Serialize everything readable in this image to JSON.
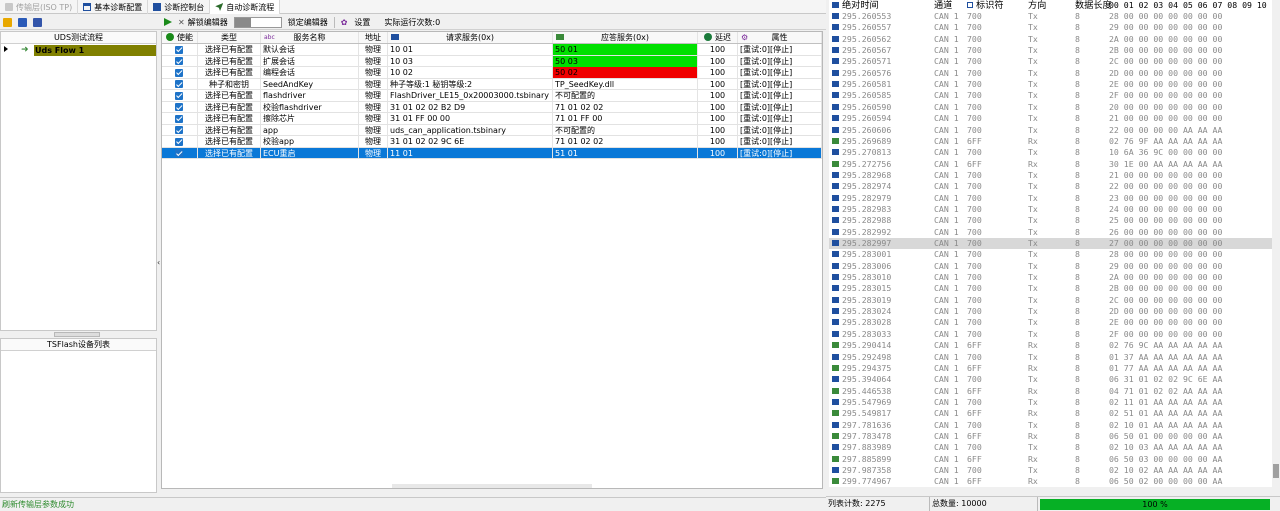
{
  "tabs": [
    {
      "label": "传输层(ISO TP)",
      "state": "disabled"
    },
    {
      "label": "基本诊断配置",
      "state": "normal"
    },
    {
      "label": "诊断控制台",
      "state": "normal"
    },
    {
      "label": "自动诊断流程",
      "state": "active"
    }
  ],
  "toolbar": {
    "unlock_editor": "解锁编辑器",
    "lock_editor": "锁定编辑器",
    "settings": "设置",
    "run_count": "实际运行次数:0"
  },
  "flow_panel": {
    "title": "UDS测试流程",
    "items": [
      {
        "label": "Uds Flow 1"
      }
    ]
  },
  "device_panel": {
    "title": "TSFlash设备列表"
  },
  "grid": {
    "columns": {
      "enable": "使能",
      "type": "类型",
      "service_name": "服务名称",
      "address": "地址",
      "request": "请求服务(0x)",
      "response": "应答服务(0x)",
      "delay": "延迟",
      "attr": "属性"
    },
    "rows": [
      {
        "type": "选择已有配置",
        "name": "默认会话",
        "addr": "物理",
        "req": "10 01",
        "resp": "50 01",
        "resp_color": "green",
        "delay": "100",
        "attr": "[重试:0][停止]"
      },
      {
        "type": "选择已有配置",
        "name": "扩展会话",
        "addr": "物理",
        "req": "10 03",
        "resp": "50 03",
        "resp_color": "green",
        "delay": "100",
        "attr": "[重试:0][停止]"
      },
      {
        "type": "选择已有配置",
        "name": "编程会话",
        "addr": "物理",
        "req": "10 02",
        "resp": "50 02",
        "resp_color": "red",
        "delay": "100",
        "attr": "[重试:0][停止]"
      },
      {
        "type": "种子和密钥",
        "name": "SeedAndKey",
        "addr": "物理",
        "req": "种子等级:1 秘钥等级:2",
        "resp": "TP_SeedKey.dll",
        "resp_color": "",
        "delay": "100",
        "attr": "[重试:0][停止]"
      },
      {
        "type": "选择已有配置",
        "name": "flashdriver",
        "addr": "物理",
        "req": "FlashDriver_LE15_0x20003000.tsbinary",
        "resp": "不可配置的",
        "resp_color": "",
        "delay": "100",
        "attr": "[重试:0][停止]"
      },
      {
        "type": "选择已有配置",
        "name": "校验flashdriver",
        "addr": "物理",
        "req": "31 01 02 02 B2 D9",
        "resp": "71 01 02 02",
        "resp_color": "",
        "delay": "100",
        "attr": "[重试:0][停止]"
      },
      {
        "type": "选择已有配置",
        "name": "擦除芯片",
        "addr": "物理",
        "req": "31 01 FF 00 00",
        "resp": "71 01 FF 00",
        "resp_color": "",
        "delay": "100",
        "attr": "[重试:0][停止]"
      },
      {
        "type": "选择已有配置",
        "name": "app",
        "addr": "物理",
        "req": "uds_can_application.tsbinary",
        "resp": "不可配置的",
        "resp_color": "",
        "delay": "100",
        "attr": "[重试:0][停止]"
      },
      {
        "type": "选择已有配置",
        "name": "校验app",
        "addr": "物理",
        "req": "31 01 02 02 9C 6E",
        "resp": "71 01 02 02",
        "resp_color": "",
        "delay": "100",
        "attr": "[重试:0][停止]"
      },
      {
        "type": "选择已有配置",
        "name": "ECU重启",
        "addr": "物理",
        "req": "11 01",
        "resp": "51 01",
        "resp_color": "",
        "delay": "100",
        "attr": "[重试:0][停止]",
        "selected": true
      }
    ]
  },
  "status": {
    "message": "刷新传输层参数成功"
  },
  "log": {
    "columns": {
      "time": "绝对时间",
      "channel": "通道",
      "id": "标识符",
      "dir": "方向",
      "dlc": "数据长度",
      "data": "00 01 02 03 04 05 06 07 08 09 10"
    },
    "rows": [
      {
        "t": "295.260553",
        "ch": "CAN 1",
        "id": "700",
        "dir": "Tx",
        "dlc": "8",
        "data": "28 00 00 00 00 00 00 00"
      },
      {
        "t": "295.260557",
        "ch": "CAN 1",
        "id": "700",
        "dir": "Tx",
        "dlc": "8",
        "data": "29 00 00 00 00 00 00 00"
      },
      {
        "t": "295.260562",
        "ch": "CAN 1",
        "id": "700",
        "dir": "Tx",
        "dlc": "8",
        "data": "2A 00 00 00 00 00 00 00"
      },
      {
        "t": "295.260567",
        "ch": "CAN 1",
        "id": "700",
        "dir": "Tx",
        "dlc": "8",
        "data": "2B 00 00 00 00 00 00 00"
      },
      {
        "t": "295.260571",
        "ch": "CAN 1",
        "id": "700",
        "dir": "Tx",
        "dlc": "8",
        "data": "2C 00 00 00 00 00 00 00"
      },
      {
        "t": "295.260576",
        "ch": "CAN 1",
        "id": "700",
        "dir": "Tx",
        "dlc": "8",
        "data": "2D 00 00 00 00 00 00 00"
      },
      {
        "t": "295.260581",
        "ch": "CAN 1",
        "id": "700",
        "dir": "Tx",
        "dlc": "8",
        "data": "2E 00 00 00 00 00 00 00"
      },
      {
        "t": "295.260585",
        "ch": "CAN 1",
        "id": "700",
        "dir": "Tx",
        "dlc": "8",
        "data": "2F 00 00 00 00 00 00 00"
      },
      {
        "t": "295.260590",
        "ch": "CAN 1",
        "id": "700",
        "dir": "Tx",
        "dlc": "8",
        "data": "20 00 00 00 00 00 00 00"
      },
      {
        "t": "295.260594",
        "ch": "CAN 1",
        "id": "700",
        "dir": "Tx",
        "dlc": "8",
        "data": "21 00 00 00 00 00 00 00"
      },
      {
        "t": "295.260606",
        "ch": "CAN 1",
        "id": "700",
        "dir": "Tx",
        "dlc": "8",
        "data": "22 00 00 00 00 AA AA AA"
      },
      {
        "t": "295.269689",
        "ch": "CAN 1",
        "id": "6FF",
        "dir": "Rx",
        "dlc": "8",
        "data": "02 76 9F AA AA AA AA AA"
      },
      {
        "t": "295.270813",
        "ch": "CAN 1",
        "id": "700",
        "dir": "Tx",
        "dlc": "8",
        "data": "10 6A 36 9C 00 00 00 00"
      },
      {
        "t": "295.272756",
        "ch": "CAN 1",
        "id": "6FF",
        "dir": "Rx",
        "dlc": "8",
        "data": "30 1E 00 AA AA AA AA AA"
      },
      {
        "t": "295.282968",
        "ch": "CAN 1",
        "id": "700",
        "dir": "Tx",
        "dlc": "8",
        "data": "21 00 00 00 00 00 00 00"
      },
      {
        "t": "295.282974",
        "ch": "CAN 1",
        "id": "700",
        "dir": "Tx",
        "dlc": "8",
        "data": "22 00 00 00 00 00 00 00"
      },
      {
        "t": "295.282979",
        "ch": "CAN 1",
        "id": "700",
        "dir": "Tx",
        "dlc": "8",
        "data": "23 00 00 00 00 00 00 00"
      },
      {
        "t": "295.282983",
        "ch": "CAN 1",
        "id": "700",
        "dir": "Tx",
        "dlc": "8",
        "data": "24 00 00 00 00 00 00 00"
      },
      {
        "t": "295.282988",
        "ch": "CAN 1",
        "id": "700",
        "dir": "Tx",
        "dlc": "8",
        "data": "25 00 00 00 00 00 00 00"
      },
      {
        "t": "295.282992",
        "ch": "CAN 1",
        "id": "700",
        "dir": "Tx",
        "dlc": "8",
        "data": "26 00 00 00 00 00 00 00"
      },
      {
        "t": "295.282997",
        "ch": "CAN 1",
        "id": "700",
        "dir": "Tx",
        "dlc": "8",
        "data": "27 00 00 00 00 00 00 00",
        "highlight": true
      },
      {
        "t": "295.283001",
        "ch": "CAN 1",
        "id": "700",
        "dir": "Tx",
        "dlc": "8",
        "data": "28 00 00 00 00 00 00 00"
      },
      {
        "t": "295.283006",
        "ch": "CAN 1",
        "id": "700",
        "dir": "Tx",
        "dlc": "8",
        "data": "29 00 00 00 00 00 00 00"
      },
      {
        "t": "295.283010",
        "ch": "CAN 1",
        "id": "700",
        "dir": "Tx",
        "dlc": "8",
        "data": "2A 00 00 00 00 00 00 00"
      },
      {
        "t": "295.283015",
        "ch": "CAN 1",
        "id": "700",
        "dir": "Tx",
        "dlc": "8",
        "data": "2B 00 00 00 00 00 00 00"
      },
      {
        "t": "295.283019",
        "ch": "CAN 1",
        "id": "700",
        "dir": "Tx",
        "dlc": "8",
        "data": "2C 00 00 00 00 00 00 00"
      },
      {
        "t": "295.283024",
        "ch": "CAN 1",
        "id": "700",
        "dir": "Tx",
        "dlc": "8",
        "data": "2D 00 00 00 00 00 00 00"
      },
      {
        "t": "295.283028",
        "ch": "CAN 1",
        "id": "700",
        "dir": "Tx",
        "dlc": "8",
        "data": "2E 00 00 00 00 00 00 00"
      },
      {
        "t": "295.283033",
        "ch": "CAN 1",
        "id": "700",
        "dir": "Tx",
        "dlc": "8",
        "data": "2F 00 00 00 00 00 00 00"
      },
      {
        "t": "295.290414",
        "ch": "CAN 1",
        "id": "6FF",
        "dir": "Rx",
        "dlc": "8",
        "data": "02 76 9C AA AA AA AA AA"
      },
      {
        "t": "295.292498",
        "ch": "CAN 1",
        "id": "700",
        "dir": "Tx",
        "dlc": "8",
        "data": "01 37 AA AA AA AA AA AA"
      },
      {
        "t": "295.294375",
        "ch": "CAN 1",
        "id": "6FF",
        "dir": "Rx",
        "dlc": "8",
        "data": "01 77 AA AA AA AA AA AA"
      },
      {
        "t": "295.394064",
        "ch": "CAN 1",
        "id": "700",
        "dir": "Tx",
        "dlc": "8",
        "data": "06 31 01 02 02 9C 6E AA"
      },
      {
        "t": "295.446538",
        "ch": "CAN 1",
        "id": "6FF",
        "dir": "Rx",
        "dlc": "8",
        "data": "04 71 01 02 02 AA AA AA"
      },
      {
        "t": "295.547969",
        "ch": "CAN 1",
        "id": "700",
        "dir": "Tx",
        "dlc": "8",
        "data": "02 11 01 AA AA AA AA AA"
      },
      {
        "t": "295.549817",
        "ch": "CAN 1",
        "id": "6FF",
        "dir": "Rx",
        "dlc": "8",
        "data": "02 51 01 AA AA AA AA AA"
      },
      {
        "t": "297.781636",
        "ch": "CAN 1",
        "id": "700",
        "dir": "Tx",
        "dlc": "8",
        "data": "02 10 01 AA AA AA AA AA"
      },
      {
        "t": "297.783478",
        "ch": "CAN 1",
        "id": "6FF",
        "dir": "Rx",
        "dlc": "8",
        "data": "06 50 01 00 00 00 00 AA"
      },
      {
        "t": "297.883989",
        "ch": "CAN 1",
        "id": "700",
        "dir": "Tx",
        "dlc": "8",
        "data": "02 10 03 AA AA AA AA AA"
      },
      {
        "t": "297.885899",
        "ch": "CAN 1",
        "id": "6FF",
        "dir": "Rx",
        "dlc": "8",
        "data": "06 50 03 00 00 00 00 AA"
      },
      {
        "t": "297.987358",
        "ch": "CAN 1",
        "id": "700",
        "dir": "Tx",
        "dlc": "8",
        "data": "02 10 02 AA AA AA AA AA"
      },
      {
        "t": "299.774967",
        "ch": "CAN 1",
        "id": "6FF",
        "dir": "Rx",
        "dlc": "8",
        "data": "06 50 02 00 00 00 00 AA"
      }
    ],
    "status": {
      "list_count": "列表计数: 2275",
      "total": "总数量: 10000",
      "progress_label": "100 %",
      "progress": 1.0
    }
  },
  "colors": {
    "selected_row": "#0a78d7",
    "ok": "#00e000",
    "fail": "#f00000",
    "flow_item": "#808000",
    "progress": "#06b025"
  }
}
